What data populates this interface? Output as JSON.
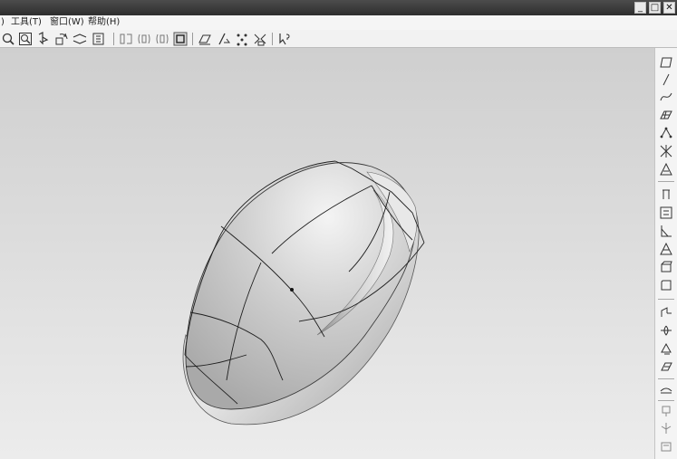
{
  "window": {
    "controls": {
      "minimize": "_",
      "maximize": "□",
      "close": "✕"
    }
  },
  "menubar": {
    "items": [
      {
        "label": ")"
      },
      {
        "label": "工具(T)"
      },
      {
        "label": "窗口(W)"
      },
      {
        "label": "帮助(H)"
      }
    ]
  },
  "toolbar": {
    "icons": [
      "zoom-icon",
      "zoom-window-icon",
      "pan-icon",
      "rotate-icon",
      "fit-view-icon",
      "view-cube-icon",
      "front-view-icon",
      "side-view-icon",
      "top-view-icon",
      "iso-view-icon",
      "wireframe-icon",
      "shaded-icon",
      "hidden-line-icon",
      "render-icon",
      "whats-this-icon"
    ]
  },
  "right_toolbar": {
    "icons": [
      "plane-icon",
      "line-icon",
      "curve-icon",
      "surface-icon",
      "point-icon",
      "intersection-icon",
      "cone-icon",
      "extrude-icon",
      "box-icon",
      "sweep-icon",
      "loft-icon",
      "revolve-icon",
      "blend-icon",
      "shell-icon",
      "draft-icon",
      "mirror-icon",
      "rotate-copy-icon",
      "pattern-icon",
      "trim-icon",
      "offset-icon",
      "split-icon",
      "measure-icon"
    ]
  },
  "viewport": {
    "model": "mouse-shell-surface",
    "colors": {
      "background_top": "#cfcfcf",
      "background_bottom": "#ececec",
      "surface": "#d9d9d9",
      "edge": "#2a2a2a"
    }
  }
}
